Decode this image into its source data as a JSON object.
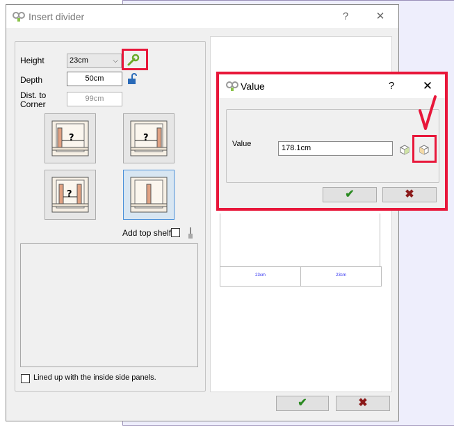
{
  "main_dialog": {
    "title": "Insert divider",
    "help": "?",
    "close": "✕",
    "height_label": "Height",
    "height_value": "23cm",
    "depth_label": "Depth",
    "depth_value": "50cm",
    "dist_label_1": "Dist. to",
    "dist_label_2": "Corner",
    "dist_value": "99cm",
    "add_top_shelf_label": "Add top shelf",
    "lined_up_label": "Lined up with the inside side panels.",
    "preview_cells": [
      "23cm",
      "23cm"
    ],
    "ok_glyph": "✔",
    "cancel_glyph": "✖"
  },
  "value_dialog": {
    "title": "Value",
    "help": "?",
    "close": "✕",
    "value_label": "Value",
    "value_input": "178.1cm",
    "ok_glyph": "✔",
    "cancel_glyph": "✖"
  },
  "colors": {
    "highlight": "#e8173a",
    "ok_green": "#2b8a22",
    "cancel_red": "#8b1a1a"
  }
}
